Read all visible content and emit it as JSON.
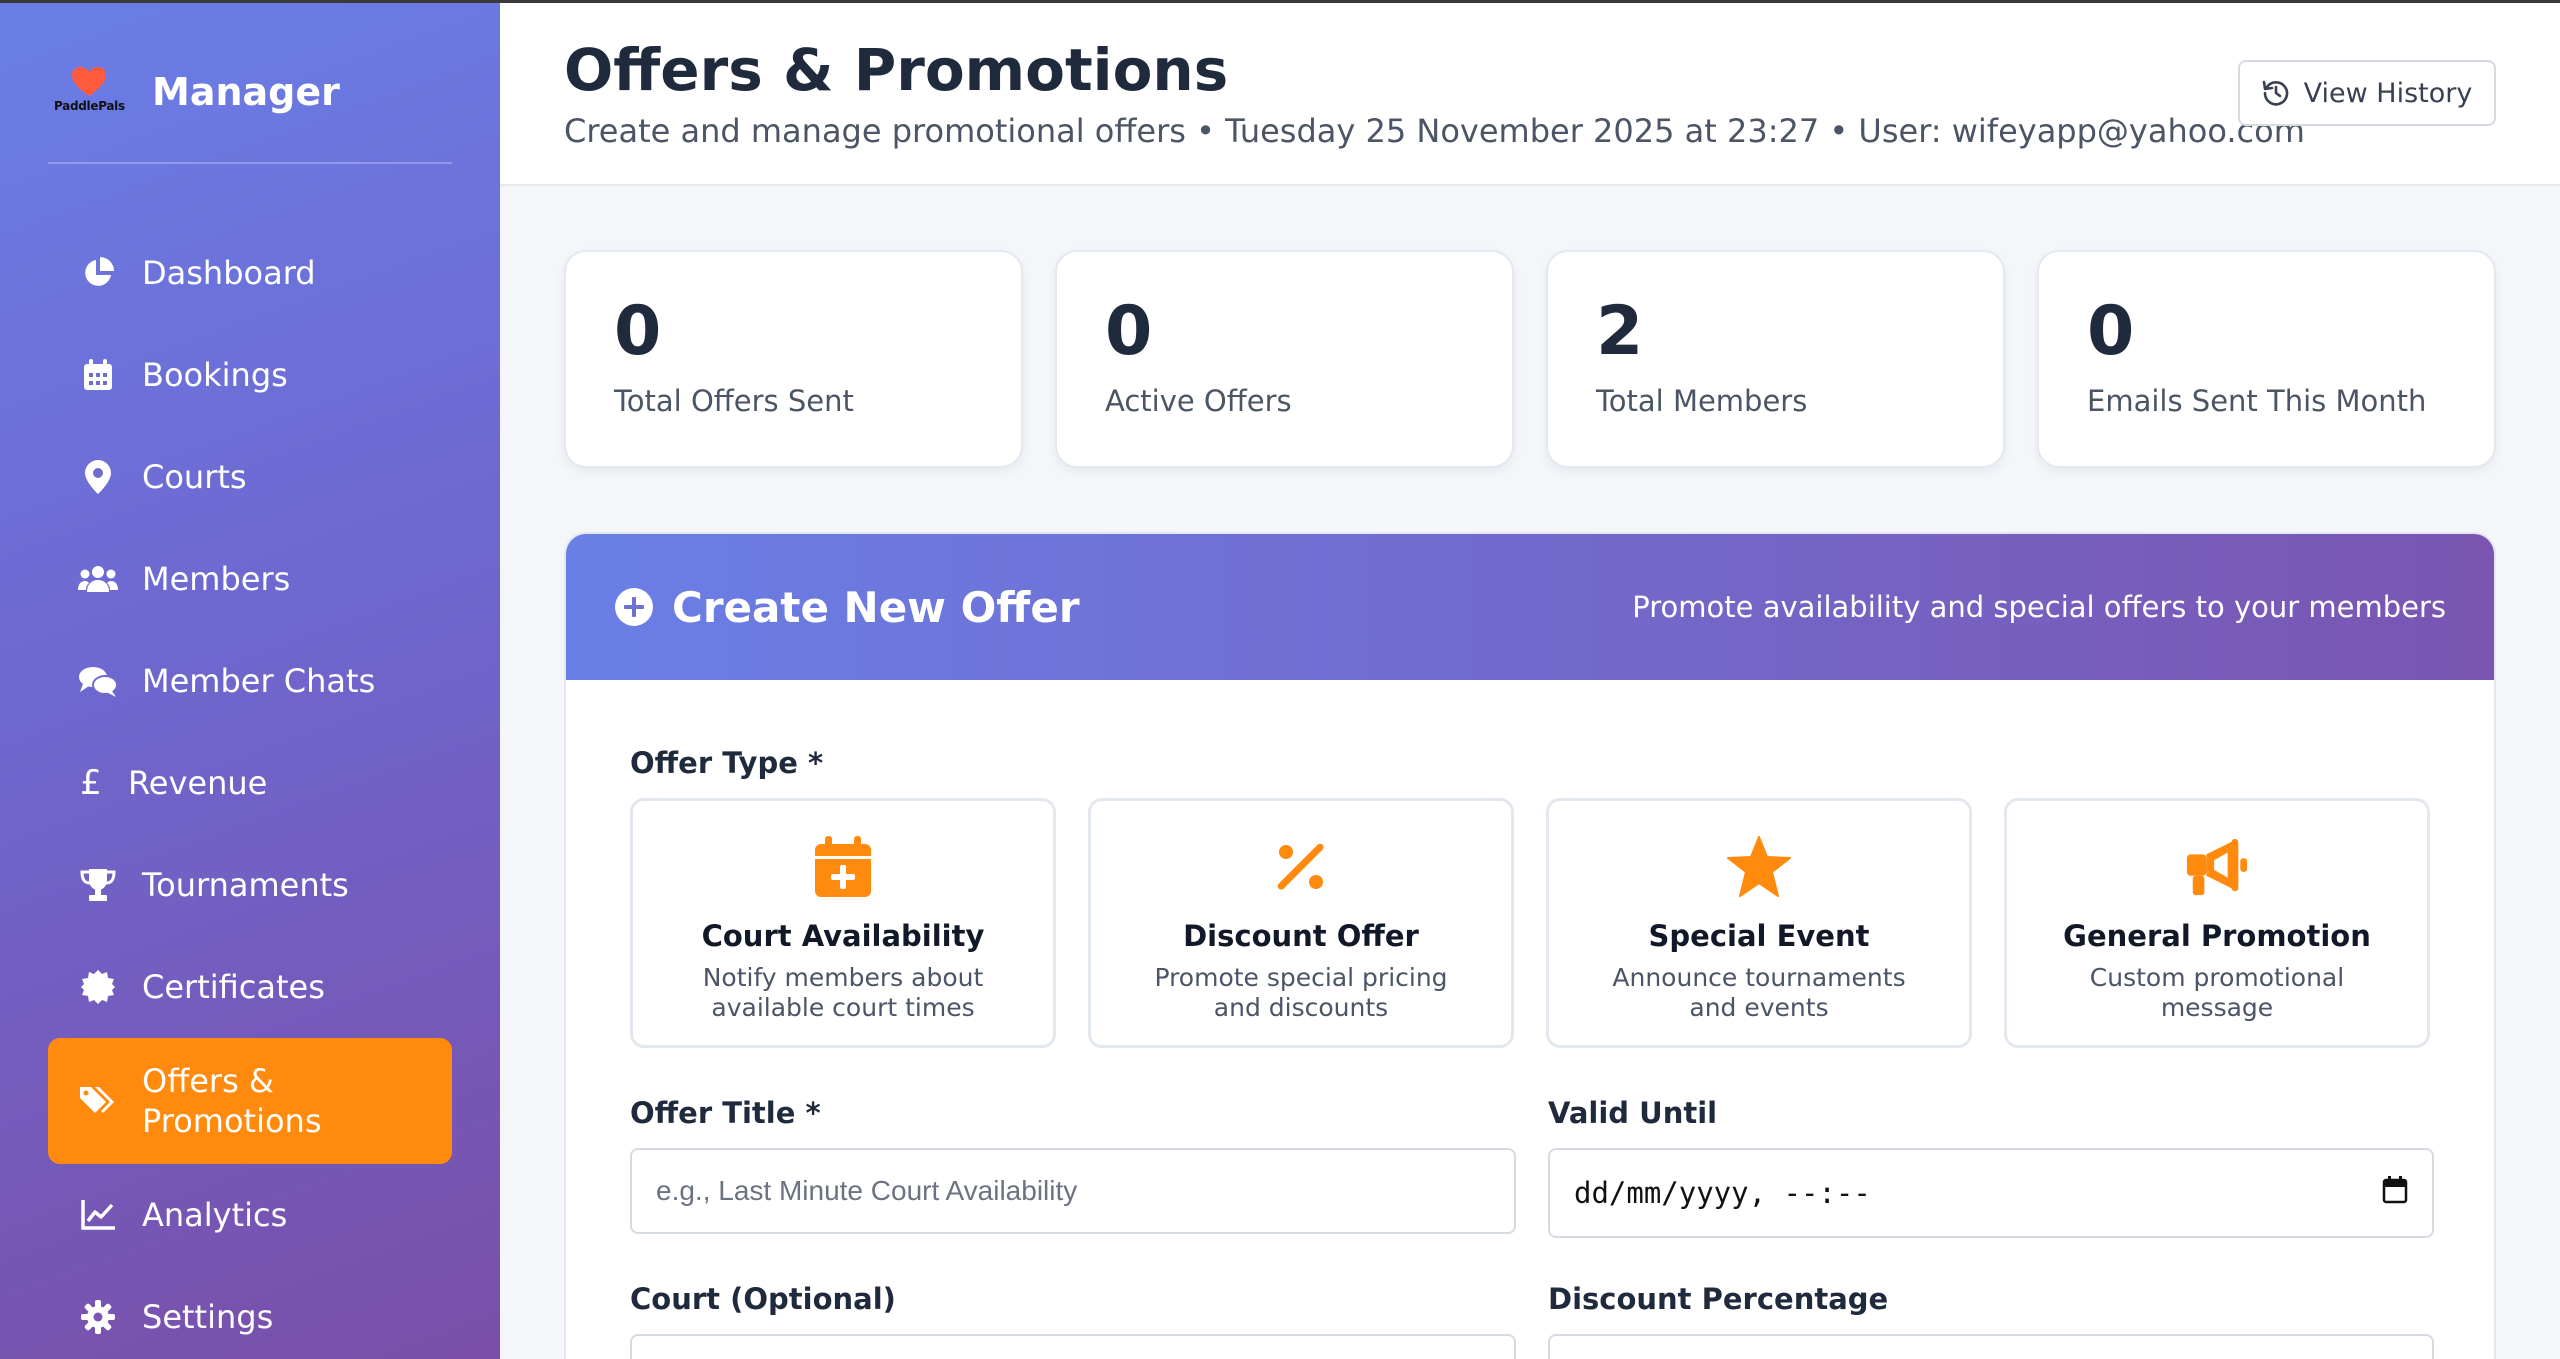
{
  "sidebar": {
    "logo_text": "PaddlePals",
    "title": "Manager",
    "items": [
      {
        "label": "Dashboard",
        "icon": "chart-pie-icon"
      },
      {
        "label": "Bookings",
        "icon": "calendar-icon"
      },
      {
        "label": "Courts",
        "icon": "map-pin-icon"
      },
      {
        "label": "Members",
        "icon": "users-icon"
      },
      {
        "label": "Member Chats",
        "icon": "chat-bubbles-icon"
      },
      {
        "label": "Revenue",
        "icon": "pound-sign-icon"
      },
      {
        "label": "Tournaments",
        "icon": "trophy-icon"
      },
      {
        "label": "Certificates",
        "icon": "certificate-icon"
      },
      {
        "label": "Offers & Promotions",
        "icon": "tags-icon",
        "active": true
      },
      {
        "label": "Analytics",
        "icon": "line-chart-icon"
      },
      {
        "label": "Settings",
        "icon": "gear-icon"
      }
    ]
  },
  "header": {
    "title": "Offers & Promotions",
    "subtitle": "Create and manage promotional offers • Tuesday 25 November 2025 at 23:27 • User: wifeyapp@yahoo.com",
    "history_button": "View History"
  },
  "stats": [
    {
      "value": "0",
      "label": "Total Offers Sent"
    },
    {
      "value": "0",
      "label": "Active Offers"
    },
    {
      "value": "2",
      "label": "Total Members"
    },
    {
      "value": "0",
      "label": "Emails Sent This Month"
    }
  ],
  "create_offer": {
    "title": "Create New Offer",
    "tagline": "Promote availability and special offers to your members",
    "offer_type_label": "Offer Type *",
    "types": [
      {
        "title": "Court Availability",
        "desc": "Notify members about available court times",
        "icon": "calendar-plus-icon"
      },
      {
        "title": "Discount Offer",
        "desc": "Promote special pricing and discounts",
        "icon": "percent-icon"
      },
      {
        "title": "Special Event",
        "desc": "Announce tournaments and events",
        "icon": "star-icon"
      },
      {
        "title": "General Promotion",
        "desc": "Custom promotional message",
        "icon": "megaphone-icon"
      }
    ],
    "offer_title_label": "Offer Title *",
    "offer_title_placeholder": "e.g., Last Minute Court Availability",
    "valid_until_label": "Valid Until",
    "valid_until_value": "dd/mm/yyyy, --:--",
    "court_label": "Court (Optional)",
    "discount_label": "Discount Percentage"
  },
  "colors": {
    "accent": "#ff8a0d",
    "sidebar_gradient_start": "#6a7fe6",
    "sidebar_gradient_end": "#7a4ea8"
  }
}
